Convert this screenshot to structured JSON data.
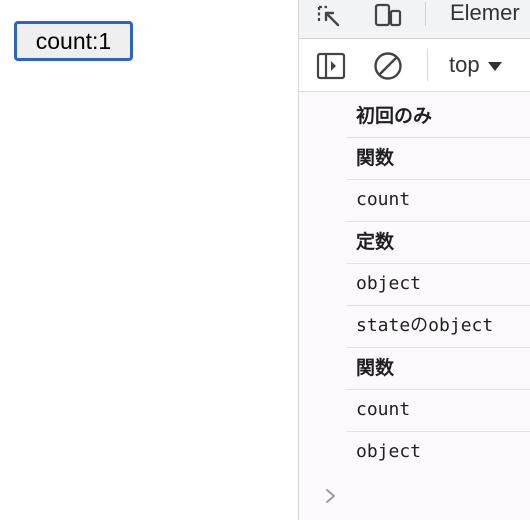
{
  "page": {
    "count_button_label": "count:1"
  },
  "devtools": {
    "tabs": {
      "inspect_icon": "inspect-element-icon",
      "device_icon": "device-toolbar-icon",
      "elements_tab_label": "Elemer"
    },
    "toolbar": {
      "sidebar_icon": "sidebar-toggle-icon",
      "clear_icon": "clear-console-icon",
      "context_label": "top",
      "context_caret_icon": "caret-down-icon"
    },
    "console": {
      "lines": [
        {
          "text": "初回のみ"
        },
        {
          "text": "関数"
        },
        {
          "text": "count"
        },
        {
          "text": "定数"
        },
        {
          "text": "object"
        },
        {
          "text": "stateのobject"
        },
        {
          "text": "関数"
        },
        {
          "text": "count"
        },
        {
          "text": "object"
        }
      ],
      "prompt_icon": "chevron-right-icon"
    }
  }
}
